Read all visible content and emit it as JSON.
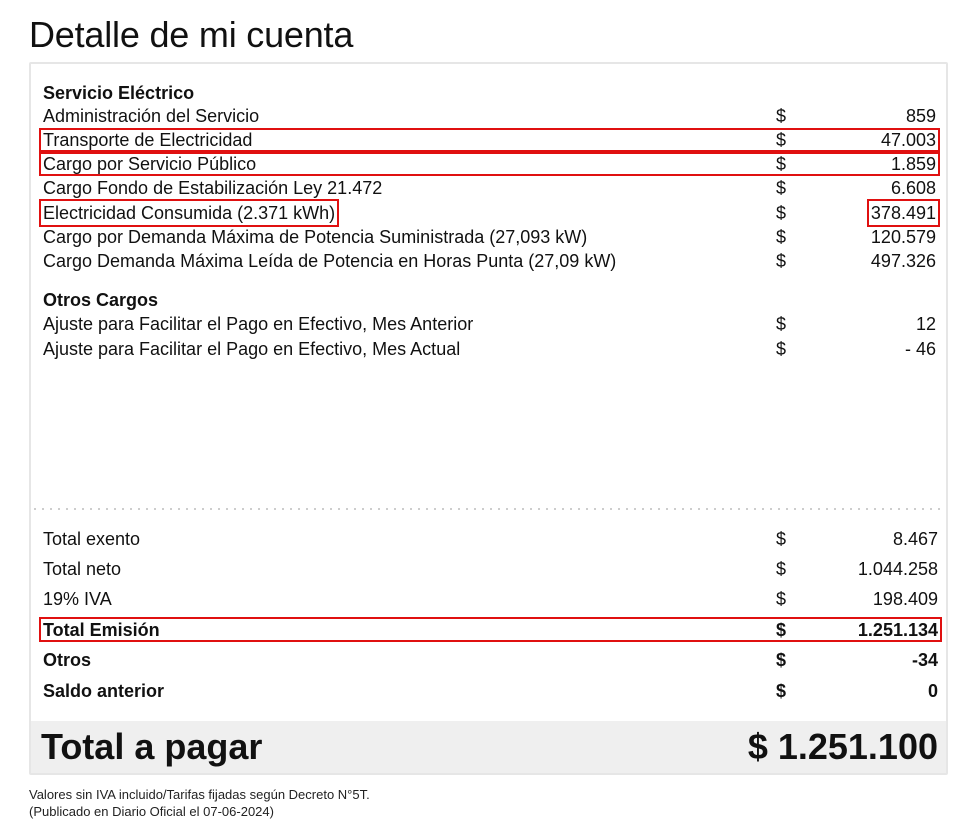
{
  "title": "Detalle de mi cuenta",
  "servicio_electrico": {
    "heading": "Servicio Eléctrico",
    "items": [
      {
        "label": "Administración del Servicio",
        "currency": "$",
        "amount": "859"
      },
      {
        "label": "Transporte de Electricidad",
        "currency": "$",
        "amount": "47.003"
      },
      {
        "label": "Cargo por Servicio Público",
        "currency": "$",
        "amount": "1.859"
      },
      {
        "label": "Cargo Fondo de Estabilización Ley 21.472",
        "currency": "$",
        "amount": "6.608"
      },
      {
        "label": "Electricidad Consumida (2.371 kWh)",
        "currency": "$",
        "amount": "378.491"
      },
      {
        "label": "Cargo por Demanda Máxima de Potencia Suministrada (27,093 kW)",
        "currency": "$",
        "amount": "120.579"
      },
      {
        "label": "Cargo Demanda Máxima Leída de Potencia en Horas Punta (27,09 kW)",
        "currency": "$",
        "amount": "497.326"
      }
    ]
  },
  "otros_cargos": {
    "heading": "Otros Cargos",
    "items": [
      {
        "label": "Ajuste para Facilitar el Pago en Efectivo, Mes Anterior",
        "currency": "$",
        "amount": "12"
      },
      {
        "label": "Ajuste para Facilitar el Pago en Efectivo, Mes Actual",
        "currency": "$",
        "amount": "- 46"
      }
    ]
  },
  "totals": [
    {
      "label": "Total exento",
      "currency": "$",
      "amount": "8.467"
    },
    {
      "label": "Total neto",
      "currency": "$",
      "amount": "1.044.258"
    },
    {
      "label": "19% IVA",
      "currency": "$",
      "amount": "198.409"
    },
    {
      "label": "Total Emisión",
      "currency": "$",
      "amount": "1.251.134"
    },
    {
      "label": "Otros",
      "currency": "$",
      "amount": "-34"
    },
    {
      "label": "Saldo anterior",
      "currency": "$",
      "amount": "0"
    }
  ],
  "total_a_pagar": {
    "label": "Total a pagar",
    "amount": "$ 1.251.100"
  },
  "footnote": {
    "line1": "Valores sin IVA incluido/Tarifas fijadas según Decreto N°5T.",
    "line2": "(Publicado en Diario Oficial el 07-06-2024)"
  },
  "colors": {
    "highlight": "#e01010",
    "total_bar": "#efefef",
    "border": "#e6e6e6"
  }
}
